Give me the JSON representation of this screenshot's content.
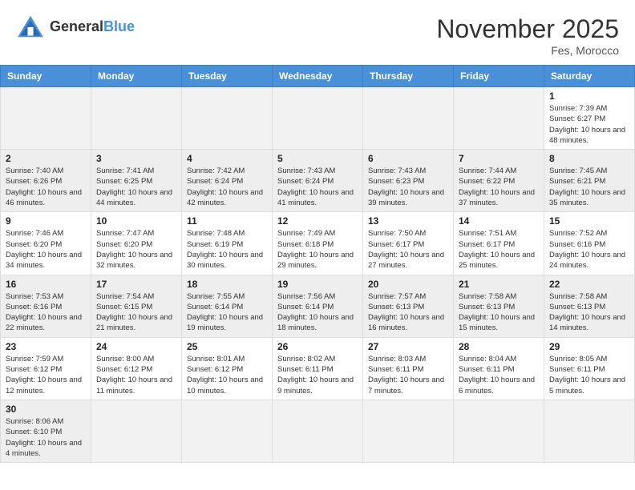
{
  "header": {
    "logo_general": "General",
    "logo_blue": "Blue",
    "month_year": "November 2025",
    "location": "Fes, Morocco"
  },
  "weekdays": [
    "Sunday",
    "Monday",
    "Tuesday",
    "Wednesday",
    "Thursday",
    "Friday",
    "Saturday"
  ],
  "days": {
    "1": {
      "sunrise": "7:39 AM",
      "sunset": "6:27 PM",
      "daylight": "10 hours and 48 minutes."
    },
    "2": {
      "sunrise": "7:40 AM",
      "sunset": "6:26 PM",
      "daylight": "10 hours and 46 minutes."
    },
    "3": {
      "sunrise": "7:41 AM",
      "sunset": "6:25 PM",
      "daylight": "10 hours and 44 minutes."
    },
    "4": {
      "sunrise": "7:42 AM",
      "sunset": "6:24 PM",
      "daylight": "10 hours and 42 minutes."
    },
    "5": {
      "sunrise": "7:43 AM",
      "sunset": "6:24 PM",
      "daylight": "10 hours and 41 minutes."
    },
    "6": {
      "sunrise": "7:43 AM",
      "sunset": "6:23 PM",
      "daylight": "10 hours and 39 minutes."
    },
    "7": {
      "sunrise": "7:44 AM",
      "sunset": "6:22 PM",
      "daylight": "10 hours and 37 minutes."
    },
    "8": {
      "sunrise": "7:45 AM",
      "sunset": "6:21 PM",
      "daylight": "10 hours and 35 minutes."
    },
    "9": {
      "sunrise": "7:46 AM",
      "sunset": "6:20 PM",
      "daylight": "10 hours and 34 minutes."
    },
    "10": {
      "sunrise": "7:47 AM",
      "sunset": "6:20 PM",
      "daylight": "10 hours and 32 minutes."
    },
    "11": {
      "sunrise": "7:48 AM",
      "sunset": "6:19 PM",
      "daylight": "10 hours and 30 minutes."
    },
    "12": {
      "sunrise": "7:49 AM",
      "sunset": "6:18 PM",
      "daylight": "10 hours and 29 minutes."
    },
    "13": {
      "sunrise": "7:50 AM",
      "sunset": "6:17 PM",
      "daylight": "10 hours and 27 minutes."
    },
    "14": {
      "sunrise": "7:51 AM",
      "sunset": "6:17 PM",
      "daylight": "10 hours and 25 minutes."
    },
    "15": {
      "sunrise": "7:52 AM",
      "sunset": "6:16 PM",
      "daylight": "10 hours and 24 minutes."
    },
    "16": {
      "sunrise": "7:53 AM",
      "sunset": "6:16 PM",
      "daylight": "10 hours and 22 minutes."
    },
    "17": {
      "sunrise": "7:54 AM",
      "sunset": "6:15 PM",
      "daylight": "10 hours and 21 minutes."
    },
    "18": {
      "sunrise": "7:55 AM",
      "sunset": "6:14 PM",
      "daylight": "10 hours and 19 minutes."
    },
    "19": {
      "sunrise": "7:56 AM",
      "sunset": "6:14 PM",
      "daylight": "10 hours and 18 minutes."
    },
    "20": {
      "sunrise": "7:57 AM",
      "sunset": "6:13 PM",
      "daylight": "10 hours and 16 minutes."
    },
    "21": {
      "sunrise": "7:58 AM",
      "sunset": "6:13 PM",
      "daylight": "10 hours and 15 minutes."
    },
    "22": {
      "sunrise": "7:58 AM",
      "sunset": "6:13 PM",
      "daylight": "10 hours and 14 minutes."
    },
    "23": {
      "sunrise": "7:59 AM",
      "sunset": "6:12 PM",
      "daylight": "10 hours and 12 minutes."
    },
    "24": {
      "sunrise": "8:00 AM",
      "sunset": "6:12 PM",
      "daylight": "10 hours and 11 minutes."
    },
    "25": {
      "sunrise": "8:01 AM",
      "sunset": "6:12 PM",
      "daylight": "10 hours and 10 minutes."
    },
    "26": {
      "sunrise": "8:02 AM",
      "sunset": "6:11 PM",
      "daylight": "10 hours and 9 minutes."
    },
    "27": {
      "sunrise": "8:03 AM",
      "sunset": "6:11 PM",
      "daylight": "10 hours and 7 minutes."
    },
    "28": {
      "sunrise": "8:04 AM",
      "sunset": "6:11 PM",
      "daylight": "10 hours and 6 minutes."
    },
    "29": {
      "sunrise": "8:05 AM",
      "sunset": "6:11 PM",
      "daylight": "10 hours and 5 minutes."
    },
    "30": {
      "sunrise": "8:06 AM",
      "sunset": "6:10 PM",
      "daylight": "10 hours and 4 minutes."
    }
  },
  "labels": {
    "sunrise": "Sunrise:",
    "sunset": "Sunset:",
    "daylight": "Daylight:"
  }
}
